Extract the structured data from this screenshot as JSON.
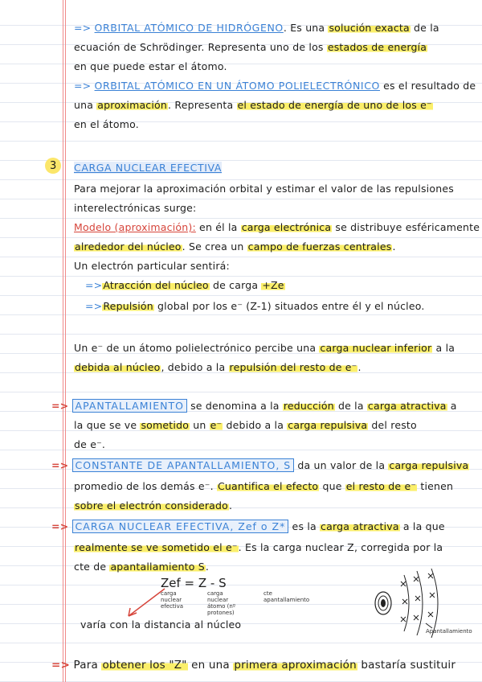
{
  "lines": {
    "l1": {
      "arrow": "=>",
      "a": "ORBITAL ATÓMICO DE HIDRÓGENO",
      "b": ". Es una ",
      "c": "solución exacta",
      "d": " de la"
    },
    "l2": {
      "a": "ecuación de Schrödinger. Representa uno de los ",
      "b": "estados de energía"
    },
    "l3": {
      "a": "en que puede estar el átomo."
    },
    "l4": {
      "arrow": "=>",
      "a": "ORBITAL ATÓMICO EN UN ÁTOMO POLIELECTRÓNICO",
      "b": " es el resultado de"
    },
    "l5": {
      "a": "una ",
      "b": "aproximación",
      "c": ". Representa ",
      "d": "el estado de energía de uno de los e⁻"
    },
    "l6": {
      "a": "en el átomo."
    },
    "l7": {
      "num": "3",
      "a": "CARGA NUCLEAR EFECTIVA"
    },
    "l8": {
      "a": "Para mejorar la aproximación orbital y estimar el valor de las repulsiones"
    },
    "l9": {
      "a": "interelectrónicas surge:"
    },
    "l10": {
      "a": "Modelo (aproximación):",
      "b": " en él la ",
      "c": "carga electrónica",
      "d": " se distribuye esféricamente"
    },
    "l11": {
      "a": "alrededor del núcleo",
      "b": ". Se crea un ",
      "c": "campo de fuerzas centrales",
      "d": "."
    },
    "l12": {
      "a": "Un electrón particular sentirá:"
    },
    "l13": {
      "arrow": "=>",
      "a": "Atracción del núcleo",
      "b": " de carga ",
      "c": "+Ze"
    },
    "l14": {
      "arrow": "=>",
      "a": "Repulsión",
      "b": " global por los e⁻ (Z-1) situados entre él y el núcleo."
    },
    "l15": {
      "a": "Un e⁻ de un átomo polielectrónico percibe una ",
      "b": "carga nuclear inferior",
      "c": " a la"
    },
    "l16": {
      "a": "debida al núcleo",
      "b": ", debido a la ",
      "c": "repulsión del resto de e⁻",
      "d": "."
    },
    "l17": {
      "arrow": "=>",
      "a": "APANTALLAMIENTO",
      "b": " se denomina a la ",
      "c": "reducción",
      "d": " de la ",
      "e": "carga atractiva",
      "f": " a"
    },
    "l18": {
      "a": "la que se ve ",
      "b": "sometido",
      "c": " un ",
      "d": "e⁻",
      "e": " debido a la ",
      "f": "carga repulsiva",
      "g": " del resto"
    },
    "l19": {
      "a": "de e⁻."
    },
    "l20": {
      "arrow": "=>",
      "a": "CONSTANTE DE APANTALLAMIENTO, S",
      "b": " da un valor de la ",
      "c": "carga repulsiva"
    },
    "l21": {
      "a": "promedio de los demás e⁻. ",
      "b": "Cuantifica el efecto",
      "c": " que ",
      "d": "el resto de e⁻",
      "e": " tienen"
    },
    "l22": {
      "a": "sobre el electrón considerado",
      "b": "."
    },
    "l23": {
      "arrow": "=>",
      "a": "CARGA NUCLEAR EFECTIVA, Zef o Z*",
      "b": " es la ",
      "c": "carga atractiva",
      "d": " a la que"
    },
    "l24": {
      "a": "realmente se ve sometido el e⁻",
      "b": ". Es la carga nuclear Z, corregida por la"
    },
    "l25": {
      "a": "cte de ",
      "b": "apantallamiento S",
      "c": "."
    },
    "l28": {
      "a": "varía con la distancia al núcleo"
    },
    "l29": {
      "arrow": "=>",
      "a": "Para ",
      "b": "obtener los \"Z\"",
      "c": " en una ",
      "d": "primera aproximación",
      "e": " bastaría sustituir"
    }
  },
  "formula": {
    "text": "Zef = Z - S",
    "label_zef": "carga nuclear efectiva",
    "label_z": "carga nuclear átomo (nº protones)",
    "label_s": "cte apantallamiento"
  },
  "diagram": {
    "label": "Apantallamiento"
  }
}
